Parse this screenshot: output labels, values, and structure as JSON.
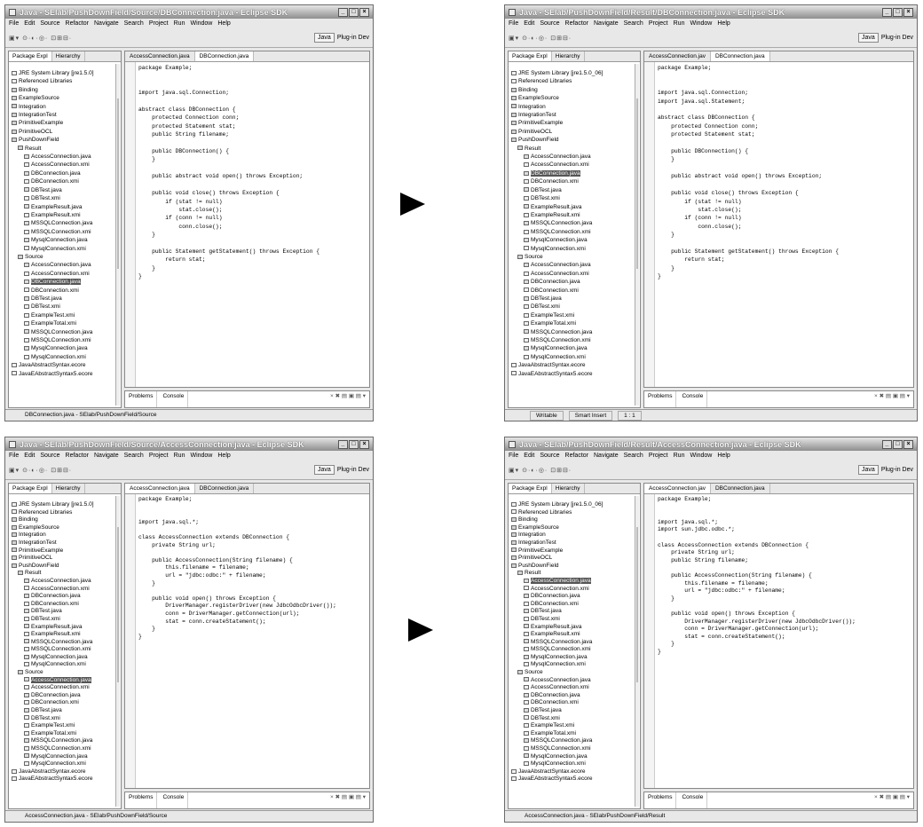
{
  "app": {
    "menu": [
      "File",
      "Edit",
      "Source",
      "Refactor",
      "Navigate",
      "Search",
      "Project",
      "Run",
      "Window",
      "Help"
    ],
    "toolbar_glyphs": "▣▾ ⊙·◐·◎· ⊡⊞⊟·",
    "perspective": "Java",
    "plugin_dev": "Plug-in Dev",
    "package_explorer_tab": "Package Expl",
    "hierarchy_tab": "Hierarchy",
    "problems_tab": "Problems",
    "console_tab": "Console",
    "console_glyphs": "× ✖ ▤ ▣ ▤ ▾"
  },
  "windows": [
    {
      "title": "Java - SElab/PushDownField/Source/DBConnection.java - Eclipse SDK",
      "editor_tabs": [
        "AccessConnection.java",
        "DBConnection.java"
      ],
      "active_editor": 1,
      "status": "DBConnection.java - SElab/PushDownField/Source",
      "status_cells": [],
      "tree": [
        {
          "t": "JRE System Library [jre1.5.0]",
          "k": "x",
          "d": 1
        },
        {
          "t": "Referenced Libraries",
          "k": "x",
          "d": 1
        },
        {
          "t": "Binding",
          "k": "f",
          "d": 1
        },
        {
          "t": "ExampleSource",
          "k": "f",
          "d": 1
        },
        {
          "t": "Integration",
          "k": "f",
          "d": 1
        },
        {
          "t": "IntegrationTest",
          "k": "f",
          "d": 1
        },
        {
          "t": "PrimitiveExample",
          "k": "f",
          "d": 1
        },
        {
          "t": "PrimitiveOCL",
          "k": "f",
          "d": 1
        },
        {
          "t": "PushDownField",
          "k": "f",
          "d": 1
        },
        {
          "t": "Result",
          "k": "f",
          "d": 2
        },
        {
          "t": "AccessConnection.java",
          "k": "j",
          "d": 3
        },
        {
          "t": "AccessConnection.xmi",
          "k": "x",
          "d": 3
        },
        {
          "t": "DBConnection.java",
          "k": "j",
          "d": 3
        },
        {
          "t": "DBConnection.xmi",
          "k": "x",
          "d": 3
        },
        {
          "t": "DBTest.java",
          "k": "j",
          "d": 3
        },
        {
          "t": "DBTest.xmi",
          "k": "x",
          "d": 3
        },
        {
          "t": "ExampleResult.java",
          "k": "j",
          "d": 3
        },
        {
          "t": "ExampleResult.xmi",
          "k": "x",
          "d": 3
        },
        {
          "t": "MSSQLConnection.java",
          "k": "j",
          "d": 3
        },
        {
          "t": "MSSQLConnection.xmi",
          "k": "x",
          "d": 3
        },
        {
          "t": "MysqlConnection.java",
          "k": "j",
          "d": 3
        },
        {
          "t": "MysqlConnection.xmi",
          "k": "x",
          "d": 3
        },
        {
          "t": "Source",
          "k": "f",
          "d": 2
        },
        {
          "t": "AccessConnection.java",
          "k": "j",
          "d": 3
        },
        {
          "t": "AccessConnection.xmi",
          "k": "x",
          "d": 3
        },
        {
          "t": "DBConnection.java",
          "k": "j",
          "d": 3,
          "sel": true
        },
        {
          "t": "DBConnection.xmi",
          "k": "x",
          "d": 3
        },
        {
          "t": "DBTest.java",
          "k": "j",
          "d": 3
        },
        {
          "t": "DBTest.xmi",
          "k": "x",
          "d": 3
        },
        {
          "t": "ExampleTest.xmi",
          "k": "x",
          "d": 3
        },
        {
          "t": "ExampleTotal.xmi",
          "k": "x",
          "d": 3
        },
        {
          "t": "MSSQLConnection.java",
          "k": "j",
          "d": 3
        },
        {
          "t": "MSSQLConnection.xmi",
          "k": "x",
          "d": 3
        },
        {
          "t": "MysqlConnection.java",
          "k": "j",
          "d": 3
        },
        {
          "t": "MysqlConnection.xmi",
          "k": "x",
          "d": 3
        },
        {
          "t": "JavaAbstractSyntax.ecore",
          "k": "x",
          "d": 1
        },
        {
          "t": "JavaEAbstractSyntax5.ecore",
          "k": "x",
          "d": 1
        }
      ],
      "code": "package Example;\n\n\nimport java.sql.Connection;\n\nabstract class DBConnection {\n    protected Connection conn;\n    protected Statement stat;\n    public String filename;\n\n    public DBConnection() {\n    }\n\n    public abstract void open() throws Exception;\n\n    public void close() throws Exception {\n        if (stat != null)\n            stat.close();\n        if (conn != null)\n            conn.close();\n    }\n\n    public Statement getStatement() throws Exception {\n        return stat;\n    }\n}"
    },
    {
      "title": "Java - SElab/PushDownField/Result/DBConnection.java - Eclipse SDK",
      "editor_tabs": [
        "AccessConnection.jav",
        "DBConnection.java"
      ],
      "active_editor": 1,
      "status": "",
      "status_cells": [
        "Writable",
        "Smart Insert",
        "1 : 1"
      ],
      "tree": [
        {
          "t": "JRE System Library [jre1.5.0_06]",
          "k": "x",
          "d": 1
        },
        {
          "t": "Referenced Libraries",
          "k": "x",
          "d": 1
        },
        {
          "t": "Binding",
          "k": "f",
          "d": 1
        },
        {
          "t": "ExampleSource",
          "k": "f",
          "d": 1
        },
        {
          "t": "Integration",
          "k": "f",
          "d": 1
        },
        {
          "t": "IntegrationTest",
          "k": "f",
          "d": 1
        },
        {
          "t": "PrimitiveExample",
          "k": "f",
          "d": 1
        },
        {
          "t": "PrimitiveOCL",
          "k": "f",
          "d": 1
        },
        {
          "t": "PushDownField",
          "k": "f",
          "d": 1
        },
        {
          "t": "Result",
          "k": "f",
          "d": 2
        },
        {
          "t": "AccessConnection.java",
          "k": "j",
          "d": 3
        },
        {
          "t": "AccessConnection.xmi",
          "k": "x",
          "d": 3
        },
        {
          "t": "DBConnection.java",
          "k": "j",
          "d": 3,
          "sel": true
        },
        {
          "t": "DBConnection.xmi",
          "k": "x",
          "d": 3
        },
        {
          "t": "DBTest.java",
          "k": "j",
          "d": 3
        },
        {
          "t": "DBTest.xmi",
          "k": "x",
          "d": 3
        },
        {
          "t": "ExampleResult.java",
          "k": "j",
          "d": 3
        },
        {
          "t": "ExampleResult.xmi",
          "k": "x",
          "d": 3
        },
        {
          "t": "MSSQLConnection.java",
          "k": "j",
          "d": 3
        },
        {
          "t": "MSSQLConnection.xmi",
          "k": "x",
          "d": 3
        },
        {
          "t": "MysqlConnection.java",
          "k": "j",
          "d": 3
        },
        {
          "t": "MysqlConnection.xmi",
          "k": "x",
          "d": 3
        },
        {
          "t": "Source",
          "k": "f",
          "d": 2
        },
        {
          "t": "AccessConnection.java",
          "k": "j",
          "d": 3
        },
        {
          "t": "AccessConnection.xmi",
          "k": "x",
          "d": 3
        },
        {
          "t": "DBConnection.java",
          "k": "j",
          "d": 3
        },
        {
          "t": "DBConnection.xmi",
          "k": "x",
          "d": 3
        },
        {
          "t": "DBTest.java",
          "k": "j",
          "d": 3
        },
        {
          "t": "DBTest.xmi",
          "k": "x",
          "d": 3
        },
        {
          "t": "ExampleTest.xmi",
          "k": "x",
          "d": 3
        },
        {
          "t": "ExampleTotal.xmi",
          "k": "x",
          "d": 3
        },
        {
          "t": "MSSQLConnection.java",
          "k": "j",
          "d": 3
        },
        {
          "t": "MSSQLConnection.xmi",
          "k": "x",
          "d": 3
        },
        {
          "t": "MysqlConnection.java",
          "k": "j",
          "d": 3
        },
        {
          "t": "MysqlConnection.xmi",
          "k": "x",
          "d": 3
        },
        {
          "t": "JavaAbstractSyntax.ecore",
          "k": "x",
          "d": 1
        },
        {
          "t": "JavaEAbstractSyntax5.ecore",
          "k": "x",
          "d": 1
        }
      ],
      "code": "package Example;\n\n\nimport java.sql.Connection;\nimport java.sql.Statement;\n\nabstract class DBConnection {\n    protected Connection conn;\n    protected Statement stat;\n\n    public DBConnection() {\n    }\n\n    public abstract void open() throws Exception;\n\n    public void close() throws Exception {\n        if (stat != null)\n            stat.close();\n        if (conn != null)\n            conn.close();\n    }\n\n    public Statement getStatement() throws Exception {\n        return stat;\n    }\n}"
    },
    {
      "title": "Java - SElab/PushDownField/Source/AccessConnection.java - Eclipse SDK",
      "editor_tabs": [
        "AccessConnection.java",
        "DBConnection.java"
      ],
      "active_editor": 0,
      "status": "AccessConnection.java - SElab/PushDownField/Source",
      "status_cells": [],
      "tree": [
        {
          "t": "JRE System Library [jre1.5.0]",
          "k": "x",
          "d": 1
        },
        {
          "t": "Referenced Libraries",
          "k": "x",
          "d": 1
        },
        {
          "t": "Binding",
          "k": "f",
          "d": 1
        },
        {
          "t": "ExampleSource",
          "k": "f",
          "d": 1
        },
        {
          "t": "Integration",
          "k": "f",
          "d": 1
        },
        {
          "t": "IntegrationTest",
          "k": "f",
          "d": 1
        },
        {
          "t": "PrimitiveExample",
          "k": "f",
          "d": 1
        },
        {
          "t": "PrimitiveOCL",
          "k": "f",
          "d": 1
        },
        {
          "t": "PushDownField",
          "k": "f",
          "d": 1
        },
        {
          "t": "Result",
          "k": "f",
          "d": 2
        },
        {
          "t": "AccessConnection.java",
          "k": "j",
          "d": 3
        },
        {
          "t": "AccessConnection.xmi",
          "k": "x",
          "d": 3
        },
        {
          "t": "DBConnection.java",
          "k": "j",
          "d": 3
        },
        {
          "t": "DBConnection.xmi",
          "k": "x",
          "d": 3
        },
        {
          "t": "DBTest.java",
          "k": "j",
          "d": 3
        },
        {
          "t": "DBTest.xmi",
          "k": "x",
          "d": 3
        },
        {
          "t": "ExampleResult.java",
          "k": "j",
          "d": 3
        },
        {
          "t": "ExampleResult.xmi",
          "k": "x",
          "d": 3
        },
        {
          "t": "MSSQLConnection.java",
          "k": "j",
          "d": 3
        },
        {
          "t": "MSSQLConnection.xmi",
          "k": "x",
          "d": 3
        },
        {
          "t": "MysqlConnection.java",
          "k": "j",
          "d": 3
        },
        {
          "t": "MysqlConnection.xmi",
          "k": "x",
          "d": 3
        },
        {
          "t": "Source",
          "k": "f",
          "d": 2
        },
        {
          "t": "AccessConnection.java",
          "k": "j",
          "d": 3,
          "sel": true
        },
        {
          "t": "AccessConnection.xmi",
          "k": "x",
          "d": 3
        },
        {
          "t": "DBConnection.java",
          "k": "j",
          "d": 3
        },
        {
          "t": "DBConnection.xmi",
          "k": "x",
          "d": 3
        },
        {
          "t": "DBTest.java",
          "k": "j",
          "d": 3
        },
        {
          "t": "DBTest.xmi",
          "k": "x",
          "d": 3
        },
        {
          "t": "ExampleTest.xmi",
          "k": "x",
          "d": 3
        },
        {
          "t": "ExampleTotal.xmi",
          "k": "x",
          "d": 3
        },
        {
          "t": "MSSQLConnection.java",
          "k": "j",
          "d": 3
        },
        {
          "t": "MSSQLConnection.xmi",
          "k": "x",
          "d": 3
        },
        {
          "t": "MysqlConnection.java",
          "k": "j",
          "d": 3
        },
        {
          "t": "MysqlConnection.xmi",
          "k": "x",
          "d": 3
        },
        {
          "t": "JavaAbstractSyntax.ecore",
          "k": "x",
          "d": 1
        },
        {
          "t": "JavaEAbstractSyntax5.ecore",
          "k": "x",
          "d": 1
        }
      ],
      "code": "package Example;\n\n\nimport java.sql.*;\n\nclass AccessConnection extends DBConnection {\n    private String url;\n\n    public AccessConnection(String filename) {\n        this.filename = filename;\n        url = \"jdbc:odbc:\" + filename;\n    }\n\n    public void open() throws Exception {\n        DriverManager.registerDriver(new JdbcOdbcDriver());\n        conn = DriverManager.getConnection(url);\n        stat = conn.createStatement();\n    }\n}"
    },
    {
      "title": "Java - SElab/PushDownField/Result/AccessConnection.java - Eclipse SDK",
      "editor_tabs": [
        "AccessConnection.jav",
        "DBConnection.java"
      ],
      "active_editor": 0,
      "status": "AccessConnection.java - SElab/PushDownField/Result",
      "status_cells": [],
      "tree": [
        {
          "t": "JRE System Library [jre1.5.0_06]",
          "k": "x",
          "d": 1
        },
        {
          "t": "Referenced Libraries",
          "k": "x",
          "d": 1
        },
        {
          "t": "Binding",
          "k": "f",
          "d": 1
        },
        {
          "t": "ExampleSource",
          "k": "f",
          "d": 1
        },
        {
          "t": "Integration",
          "k": "f",
          "d": 1
        },
        {
          "t": "IntegrationTest",
          "k": "f",
          "d": 1
        },
        {
          "t": "PrimitiveExample",
          "k": "f",
          "d": 1
        },
        {
          "t": "PrimitiveOCL",
          "k": "f",
          "d": 1
        },
        {
          "t": "PushDownField",
          "k": "f",
          "d": 1
        },
        {
          "t": "Result",
          "k": "f",
          "d": 2
        },
        {
          "t": "AccessConnection.java",
          "k": "j",
          "d": 3,
          "sel": true
        },
        {
          "t": "AccessConnection.xmi",
          "k": "x",
          "d": 3
        },
        {
          "t": "DBConnection.java",
          "k": "j",
          "d": 3
        },
        {
          "t": "DBConnection.xmi",
          "k": "x",
          "d": 3
        },
        {
          "t": "DBTest.java",
          "k": "j",
          "d": 3
        },
        {
          "t": "DBTest.xmi",
          "k": "x",
          "d": 3
        },
        {
          "t": "ExampleResult.java",
          "k": "j",
          "d": 3
        },
        {
          "t": "ExampleResult.xmi",
          "k": "x",
          "d": 3
        },
        {
          "t": "MSSQLConnection.java",
          "k": "j",
          "d": 3
        },
        {
          "t": "MSSQLConnection.xmi",
          "k": "x",
          "d": 3
        },
        {
          "t": "MysqlConnection.java",
          "k": "j",
          "d": 3
        },
        {
          "t": "MysqlConnection.xmi",
          "k": "x",
          "d": 3
        },
        {
          "t": "Source",
          "k": "f",
          "d": 2
        },
        {
          "t": "AccessConnection.java",
          "k": "j",
          "d": 3
        },
        {
          "t": "AccessConnection.xmi",
          "k": "x",
          "d": 3
        },
        {
          "t": "DBConnection.java",
          "k": "j",
          "d": 3
        },
        {
          "t": "DBConnection.xmi",
          "k": "x",
          "d": 3
        },
        {
          "t": "DBTest.java",
          "k": "j",
          "d": 3
        },
        {
          "t": "DBTest.xmi",
          "k": "x",
          "d": 3
        },
        {
          "t": "ExampleTest.xmi",
          "k": "x",
          "d": 3
        },
        {
          "t": "ExampleTotal.xmi",
          "k": "x",
          "d": 3
        },
        {
          "t": "MSSQLConnection.java",
          "k": "j",
          "d": 3
        },
        {
          "t": "MSSQLConnection.xmi",
          "k": "x",
          "d": 3
        },
        {
          "t": "MysqlConnection.java",
          "k": "j",
          "d": 3
        },
        {
          "t": "MysqlConnection.xmi",
          "k": "x",
          "d": 3
        },
        {
          "t": "JavaAbstractSyntax.ecore",
          "k": "x",
          "d": 1
        },
        {
          "t": "JavaEAbstractSyntax5.ecore",
          "k": "x",
          "d": 1
        }
      ],
      "code": "package Example;\n\n\nimport java.sql.*;\nimport sun.jdbc.odbc.*;\n\nclass AccessConnection extends DBConnection {\n    private String url;\n    public String filename;\n\n    public AccessConnection(String filename) {\n        this.filename = filename;\n        url = \"jdbc:odbc:\" + filename;\n    }\n\n    public void open() throws Exception {\n        DriverManager.registerDriver(new JdbcOdbcDriver());\n        conn = DriverManager.getConnection(url);\n        stat = conn.createStatement();\n    }\n}"
    }
  ]
}
